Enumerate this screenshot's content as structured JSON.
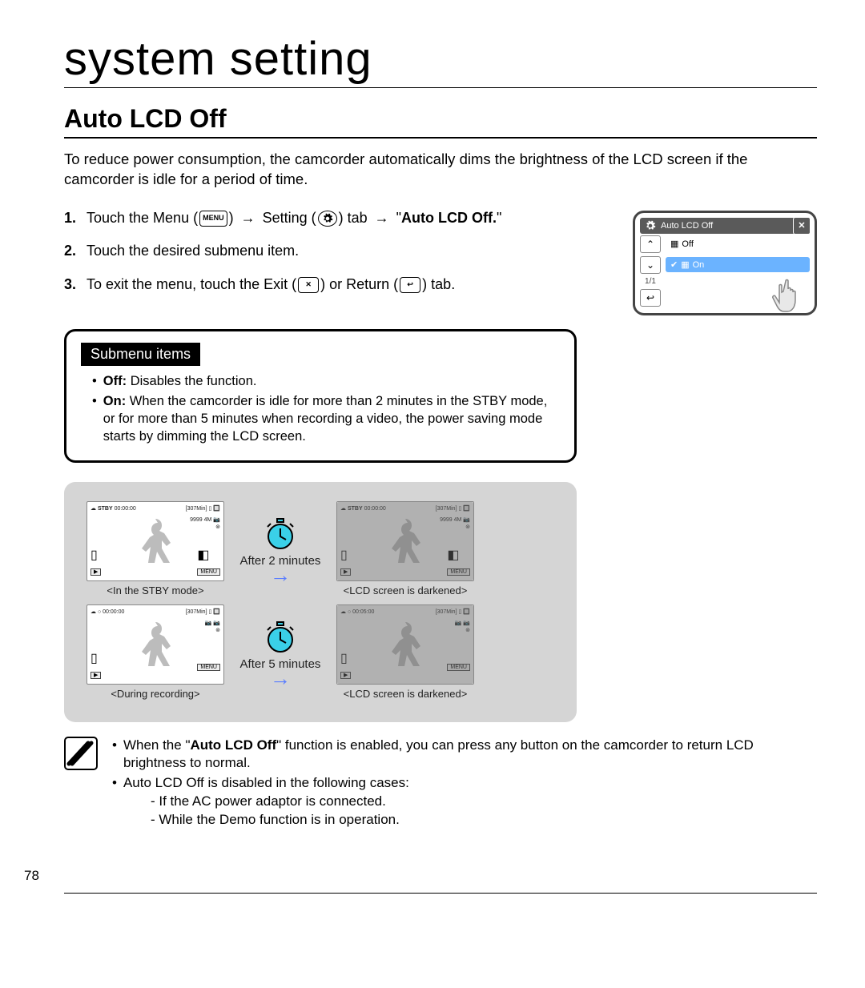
{
  "chapter": "system setting",
  "section": "Auto LCD Off",
  "intro": "To reduce power consumption, the camcorder automatically dims the brightness of the LCD screen if the camcorder is idle for a period of time.",
  "steps": {
    "s1_a": "Touch the Menu (",
    "s1_menu": "MENU",
    "s1_b": ") ",
    "s1_arrow": "→",
    "s1_c": " Setting (",
    "s1_d": ") tab ",
    "s1_e": " \"",
    "s1_bold": "Auto LCD Off.",
    "s1_f": "\"",
    "s2": "Touch the desired submenu item.",
    "s3_a": "To exit the menu, touch the Exit (",
    "s3_b": ") or Return (",
    "s3_c": ") tab."
  },
  "menu_shot": {
    "title": "Auto LCD Off",
    "opt_off": "Off",
    "opt_on": "On",
    "page": "1/1"
  },
  "submenu": {
    "heading": "Submenu items",
    "off_label": "Off:",
    "off_text": " Disables the function.",
    "on_label": "On:",
    "on_text": " When the camcorder is idle for more than 2 minutes in the STBY mode, or for more than 5 minutes when recording a video, the power saving mode starts by dimming the LCD screen."
  },
  "diagram": {
    "after2": "After 2 minutes",
    "after5": "After 5 minutes",
    "cap_stby": "<In the STBY mode>",
    "cap_dark": "<LCD screen is darkened>",
    "cap_rec": "<During recording>",
    "stby_label": "STBY",
    "time0": "00:00:00",
    "time5": "00:05:00",
    "remain": "[307Min]",
    "res": "9999",
    "px": "4M",
    "menu": "MENU"
  },
  "notes": {
    "n1_a": "When the \"",
    "n1_bold": "Auto LCD Off",
    "n1_b": "\" function is enabled, you can press any button on the camcorder to return LCD brightness to normal.",
    "n2": "Auto LCD Off is disabled in the following cases:",
    "n2a": "If the AC power adaptor is connected.",
    "n2b": "While the Demo function is in operation."
  },
  "page_number": "78"
}
